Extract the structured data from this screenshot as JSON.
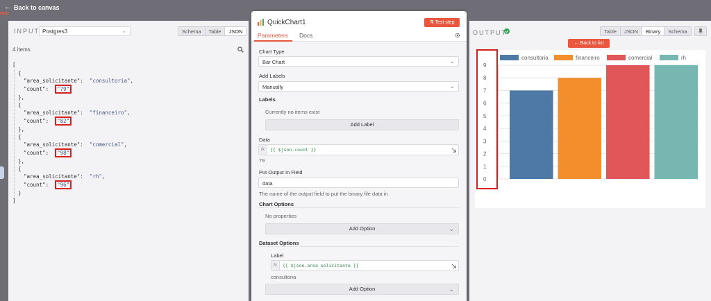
{
  "topbar": {
    "back_label": "Back to canvas"
  },
  "input": {
    "title": "INPUT",
    "source": "Postgres3",
    "tabs": [
      "Schema",
      "Table",
      "JSON"
    ],
    "active_tab": "JSON",
    "items_count": "4 items",
    "records": [
      {
        "key1": "\"area_solicitante\"",
        "value1": "\"consultoria\"",
        "key2": "\"count\"",
        "value2": "\"79\""
      },
      {
        "key1": "\"area_solicitante\"",
        "value1": "\"financeiro\"",
        "key2": "\"count\"",
        "value2": "\"82\""
      },
      {
        "key1": "\"area_solicitante\"",
        "value1": "\"comercial\"",
        "key2": "\"count\"",
        "value2": "\"98\""
      },
      {
        "key1": "\"area_solicitante\"",
        "value1": "\"rh\"",
        "key2": "\"count\"",
        "value2": "\"96\""
      }
    ]
  },
  "node": {
    "title": "QuickChart1",
    "test_button": "Test step",
    "tabs": [
      "Parameters",
      "Docs"
    ],
    "chart_type_label": "Chart Type",
    "chart_type_value": "Bar Chart",
    "add_labels_label": "Add Labels",
    "add_labels_value": "Manually",
    "labels_label": "Labels",
    "labels_empty": "Currently no items exist",
    "add_label_button": "Add Label",
    "data_label": "Data",
    "data_expression": "{{ $json.count }}",
    "data_preview": "79",
    "output_field_label": "Put Output In Field",
    "output_field_value": "data",
    "output_field_hint": "The name of the output field to put the binary file data in",
    "chart_options_label": "Chart Options",
    "chart_options_empty": "No properties",
    "add_option_button": "Add Option",
    "dataset_options_label": "Dataset Options",
    "dataset_label_label": "Label",
    "dataset_label_expression": "{{ $json.area_solicitante }}",
    "dataset_label_preview": "consultoria",
    "add_option_button_2": "Add Option"
  },
  "output": {
    "title": "OUTPUT",
    "tabs": [
      "Table",
      "JSON",
      "Binary",
      "Schema"
    ],
    "active_tab": "Binary",
    "back_to_list": "Back to list"
  },
  "chart_data": {
    "type": "bar",
    "categories": [
      "consultoria",
      "financeiro",
      "comercial",
      "rh"
    ],
    "values": [
      7,
      8,
      9,
      9
    ],
    "colors": [
      "#4e79a7",
      "#f28e2b",
      "#e15759",
      "#76b7b2"
    ],
    "ylim": [
      0,
      9
    ],
    "yticks": [
      "0",
      "1",
      "2",
      "3",
      "4",
      "5",
      "6",
      "7",
      "8",
      "9"
    ],
    "legend": "top",
    "grid": true
  }
}
